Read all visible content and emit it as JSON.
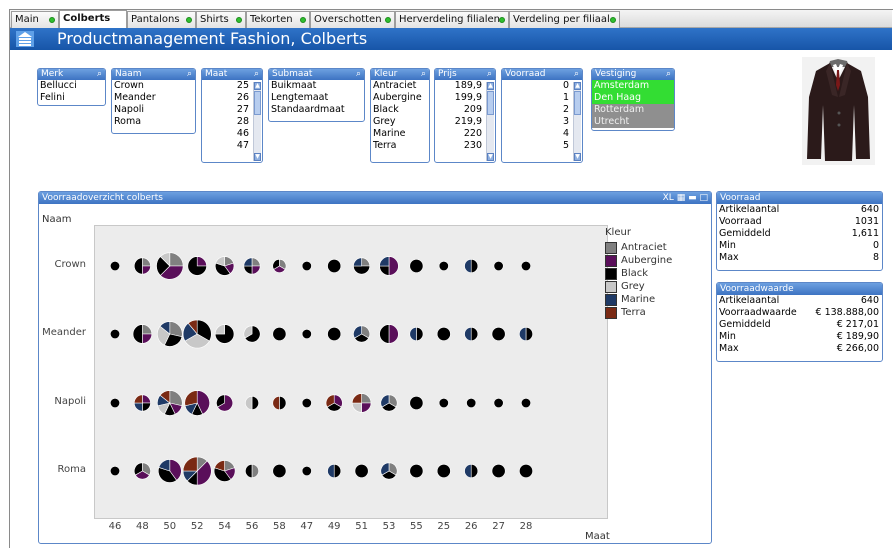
{
  "tabs": [
    {
      "label": "Main"
    },
    {
      "label": "Colberts"
    },
    {
      "label": "Pantalons"
    },
    {
      "label": "Shirts"
    },
    {
      "label": "Tekorten"
    },
    {
      "label": "Overschotten"
    },
    {
      "label": "Herverdeling filialen"
    },
    {
      "label": "Verdeling per filiaal"
    }
  ],
  "header": {
    "title": "Productmanagement Fashion, Colberts"
  },
  "listboxes": {
    "merk": {
      "title": "Merk",
      "items": [
        "Bellucci",
        "Felini"
      ]
    },
    "naam": {
      "title": "Naam",
      "items": [
        "Crown",
        "Meander",
        "Napoli",
        "Roma"
      ]
    },
    "maat": {
      "title": "Maat",
      "items": [
        "25",
        "26",
        "27",
        "28",
        "46",
        "47"
      ]
    },
    "submaat": {
      "title": "Submaat",
      "items": [
        "Buikmaat",
        "Lengtemaat",
        "Standaardmaat"
      ]
    },
    "kleur": {
      "title": "Kleur",
      "items": [
        "Antraciet",
        "Aubergine",
        "Black",
        "Grey",
        "Marine",
        "Terra"
      ]
    },
    "prijs": {
      "title": "Prijs",
      "items": [
        "189,9",
        "199,9",
        "209",
        "219,9",
        "220",
        "230"
      ]
    },
    "voorraad": {
      "title": "Voorraad",
      "items": [
        "0",
        "1",
        "2",
        "3",
        "4",
        "5"
      ]
    },
    "vestiging": {
      "title": "Vestiging",
      "items": [
        "Amsterdam",
        "Den Haag",
        "Rotterdam",
        "Utrecht"
      ],
      "selected": [
        "Amsterdam",
        "Den Haag"
      ]
    }
  },
  "chart": {
    "title": "Voorraadoverzicht colberts",
    "row_dimension": "Naam",
    "x_dimension": "Maat",
    "legend_title": "Kleur"
  },
  "chart_data": {
    "type": "scatter",
    "title": "Voorraadoverzicht colberts",
    "ylabel": "Naam",
    "xlabel": "Maat",
    "categories_y": [
      "Crown",
      "Meander",
      "Napoli",
      "Roma"
    ],
    "categories_x": [
      "46",
      "48",
      "50",
      "52",
      "54",
      "56",
      "58",
      "47",
      "49",
      "51",
      "53",
      "55",
      "25",
      "26",
      "27",
      "28"
    ],
    "series": [
      {
        "name": "Antraciet",
        "color": "#808080"
      },
      {
        "name": "Aubergine",
        "color": "#5a0f5a"
      },
      {
        "name": "Black",
        "color": "#000000"
      },
      {
        "name": "Grey",
        "color": "#c8c8c8"
      },
      {
        "name": "Marine",
        "color": "#1f3a66"
      },
      {
        "name": "Terra",
        "color": "#7a2a14"
      }
    ],
    "bubbles": [
      {
        "row": "Crown",
        "x": "46",
        "size": 1,
        "mix": [
          0,
          0,
          1,
          0,
          0,
          0
        ]
      },
      {
        "row": "Crown",
        "x": "48",
        "size": 3,
        "mix": [
          1,
          1,
          2,
          0,
          0,
          0
        ]
      },
      {
        "row": "Crown",
        "x": "50",
        "size": 8,
        "mix": [
          2,
          3,
          2,
          1,
          0,
          0
        ]
      },
      {
        "row": "Crown",
        "x": "52",
        "size": 4,
        "mix": [
          0,
          1,
          3,
          0,
          0,
          0
        ]
      },
      {
        "row": "Crown",
        "x": "54",
        "size": 4,
        "mix": [
          1,
          1,
          2,
          1,
          0,
          0
        ]
      },
      {
        "row": "Crown",
        "x": "56",
        "size": 3,
        "mix": [
          1,
          1,
          1,
          0,
          1,
          0
        ]
      },
      {
        "row": "Crown",
        "x": "58",
        "size": 2,
        "mix": [
          1,
          1,
          1,
          0,
          0,
          0
        ]
      },
      {
        "row": "Crown",
        "x": "47",
        "size": 1,
        "mix": [
          0,
          0,
          1,
          0,
          0,
          0
        ]
      },
      {
        "row": "Crown",
        "x": "49",
        "size": 2,
        "mix": [
          0,
          0,
          2,
          0,
          0,
          0
        ]
      },
      {
        "row": "Crown",
        "x": "51",
        "size": 3,
        "mix": [
          1,
          0,
          2,
          0,
          1,
          0
        ]
      },
      {
        "row": "Crown",
        "x": "53",
        "size": 4,
        "mix": [
          0,
          2,
          1,
          0,
          1,
          0
        ]
      },
      {
        "row": "Crown",
        "x": "55",
        "size": 2,
        "mix": [
          0,
          0,
          2,
          0,
          0,
          0
        ]
      },
      {
        "row": "Crown",
        "x": "25",
        "size": 1,
        "mix": [
          0,
          0,
          1,
          0,
          0,
          0
        ]
      },
      {
        "row": "Crown",
        "x": "26",
        "size": 2,
        "mix": [
          0,
          0,
          1,
          0,
          1,
          0
        ]
      },
      {
        "row": "Crown",
        "x": "27",
        "size": 1,
        "mix": [
          0,
          0,
          1,
          0,
          0,
          0
        ]
      },
      {
        "row": "Crown",
        "x": "28",
        "size": 1,
        "mix": [
          0,
          0,
          1,
          0,
          0,
          0
        ]
      },
      {
        "row": "Meander",
        "x": "46",
        "size": 1,
        "mix": [
          0,
          0,
          1,
          0,
          0,
          0
        ]
      },
      {
        "row": "Meander",
        "x": "48",
        "size": 4,
        "mix": [
          1,
          1,
          2,
          0,
          0,
          0
        ]
      },
      {
        "row": "Meander",
        "x": "50",
        "size": 7,
        "mix": [
          2,
          0,
          2,
          2,
          1,
          0
        ]
      },
      {
        "row": "Meander",
        "x": "52",
        "size": 9,
        "mix": [
          0,
          0,
          3,
          3,
          2,
          1
        ]
      },
      {
        "row": "Meander",
        "x": "54",
        "size": 4,
        "mix": [
          0,
          0,
          3,
          1,
          0,
          0
        ]
      },
      {
        "row": "Meander",
        "x": "56",
        "size": 3,
        "mix": [
          0,
          0,
          2,
          1,
          0,
          0
        ]
      },
      {
        "row": "Meander",
        "x": "58",
        "size": 2,
        "mix": [
          0,
          0,
          2,
          0,
          0,
          0
        ]
      },
      {
        "row": "Meander",
        "x": "47",
        "size": 1,
        "mix": [
          0,
          0,
          1,
          0,
          0,
          0
        ]
      },
      {
        "row": "Meander",
        "x": "49",
        "size": 2,
        "mix": [
          0,
          0,
          2,
          0,
          0,
          0
        ]
      },
      {
        "row": "Meander",
        "x": "51",
        "size": 3,
        "mix": [
          1,
          0,
          1,
          0,
          1,
          0
        ]
      },
      {
        "row": "Meander",
        "x": "53",
        "size": 4,
        "mix": [
          0,
          2,
          2,
          0,
          0,
          0
        ]
      },
      {
        "row": "Meander",
        "x": "55",
        "size": 2,
        "mix": [
          0,
          0,
          1,
          0,
          1,
          0
        ]
      },
      {
        "row": "Meander",
        "x": "25",
        "size": 2,
        "mix": [
          0,
          0,
          2,
          0,
          0,
          0
        ]
      },
      {
        "row": "Meander",
        "x": "26",
        "size": 2,
        "mix": [
          0,
          0,
          1,
          0,
          1,
          0
        ]
      },
      {
        "row": "Meander",
        "x": "27",
        "size": 2,
        "mix": [
          0,
          0,
          2,
          0,
          0,
          0
        ]
      },
      {
        "row": "Meander",
        "x": "28",
        "size": 2,
        "mix": [
          0,
          0,
          1,
          0,
          1,
          0
        ]
      },
      {
        "row": "Napoli",
        "x": "46",
        "size": 1,
        "mix": [
          0,
          0,
          1,
          0,
          0,
          0
        ]
      },
      {
        "row": "Napoli",
        "x": "48",
        "size": 3,
        "mix": [
          0,
          1,
          1,
          0,
          1,
          1
        ]
      },
      {
        "row": "Napoli",
        "x": "50",
        "size": 7,
        "mix": [
          2,
          1,
          1,
          1,
          1,
          1
        ]
      },
      {
        "row": "Napoli",
        "x": "52",
        "size": 7,
        "mix": [
          0,
          3,
          1,
          0,
          1,
          2
        ]
      },
      {
        "row": "Napoli",
        "x": "54",
        "size": 3,
        "mix": [
          0,
          2,
          1,
          0,
          0,
          0
        ]
      },
      {
        "row": "Napoli",
        "x": "56",
        "size": 2,
        "mix": [
          0,
          0,
          1,
          1,
          0,
          0
        ]
      },
      {
        "row": "Napoli",
        "x": "58",
        "size": 2,
        "mix": [
          0,
          0,
          1,
          0,
          0,
          1
        ]
      },
      {
        "row": "Napoli",
        "x": "47",
        "size": 1,
        "mix": [
          0,
          0,
          1,
          0,
          0,
          0
        ]
      },
      {
        "row": "Napoli",
        "x": "49",
        "size": 3,
        "mix": [
          0,
          1,
          1,
          0,
          0,
          1
        ]
      },
      {
        "row": "Napoli",
        "x": "51",
        "size": 4,
        "mix": [
          1,
          1,
          0,
          1,
          0,
          1
        ]
      },
      {
        "row": "Napoli",
        "x": "53",
        "size": 3,
        "mix": [
          1,
          0,
          1,
          0,
          1,
          0
        ]
      },
      {
        "row": "Napoli",
        "x": "55",
        "size": 2,
        "mix": [
          0,
          0,
          2,
          0,
          0,
          0
        ]
      },
      {
        "row": "Napoli",
        "x": "25",
        "size": 1,
        "mix": [
          0,
          0,
          1,
          0,
          0,
          0
        ]
      },
      {
        "row": "Napoli",
        "x": "26",
        "size": 1,
        "mix": [
          0,
          0,
          1,
          0,
          0,
          0
        ]
      },
      {
        "row": "Napoli",
        "x": "27",
        "size": 1,
        "mix": [
          0,
          0,
          1,
          0,
          0,
          0
        ]
      },
      {
        "row": "Napoli",
        "x": "28",
        "size": 1,
        "mix": [
          0,
          0,
          1,
          0,
          0,
          0
        ]
      },
      {
        "row": "Roma",
        "x": "46",
        "size": 1,
        "mix": [
          0,
          0,
          1,
          0,
          0,
          0
        ]
      },
      {
        "row": "Roma",
        "x": "48",
        "size": 3,
        "mix": [
          1,
          1,
          1,
          0,
          0,
          0
        ]
      },
      {
        "row": "Roma",
        "x": "50",
        "size": 6,
        "mix": [
          0,
          2,
          2,
          0,
          1,
          0
        ]
      },
      {
        "row": "Roma",
        "x": "52",
        "size": 9,
        "mix": [
          1,
          3,
          1,
          0,
          1,
          2
        ]
      },
      {
        "row": "Roma",
        "x": "54",
        "size": 5,
        "mix": [
          1,
          1,
          2,
          0,
          0,
          1
        ]
      },
      {
        "row": "Roma",
        "x": "56",
        "size": 2,
        "mix": [
          1,
          0,
          1,
          0,
          0,
          0
        ]
      },
      {
        "row": "Roma",
        "x": "58",
        "size": 2,
        "mix": [
          0,
          0,
          2,
          0,
          0,
          0
        ]
      },
      {
        "row": "Roma",
        "x": "47",
        "size": 1,
        "mix": [
          0,
          0,
          1,
          0,
          0,
          0
        ]
      },
      {
        "row": "Roma",
        "x": "49",
        "size": 2,
        "mix": [
          0,
          0,
          1,
          0,
          1,
          0
        ]
      },
      {
        "row": "Roma",
        "x": "51",
        "size": 2,
        "mix": [
          0,
          0,
          2,
          0,
          0,
          0
        ]
      },
      {
        "row": "Roma",
        "x": "53",
        "size": 3,
        "mix": [
          1,
          0,
          1,
          0,
          1,
          0
        ]
      },
      {
        "row": "Roma",
        "x": "55",
        "size": 2,
        "mix": [
          0,
          0,
          2,
          0,
          0,
          0
        ]
      },
      {
        "row": "Roma",
        "x": "25",
        "size": 2,
        "mix": [
          0,
          0,
          2,
          0,
          0,
          0
        ]
      },
      {
        "row": "Roma",
        "x": "26",
        "size": 2,
        "mix": [
          0,
          0,
          1,
          0,
          1,
          0
        ]
      },
      {
        "row": "Roma",
        "x": "27",
        "size": 2,
        "mix": [
          0,
          0,
          2,
          0,
          0,
          0
        ]
      },
      {
        "row": "Roma",
        "x": "28",
        "size": 2,
        "mix": [
          0,
          0,
          2,
          0,
          0,
          0
        ]
      }
    ]
  },
  "voorraad_table": {
    "title": "Voorraad",
    "rows": [
      {
        "label": "Artikelaantal",
        "value": "640"
      },
      {
        "label": "Voorraad",
        "value": "1031"
      },
      {
        "label": "Gemiddeld",
        "value": "1,611"
      },
      {
        "label": "Min",
        "value": "0"
      },
      {
        "label": "Max",
        "value": "8"
      }
    ]
  },
  "waarde_table": {
    "title": "Voorraadwaarde",
    "rows": [
      {
        "label": "Artikelaantal",
        "value": "640"
      },
      {
        "label": "Voorraadwaarde",
        "value": "€ 138.888,00"
      },
      {
        "label": "Gemiddeld",
        "value": "€ 217,01"
      },
      {
        "label": "Min",
        "value": "€ 189,90"
      },
      {
        "label": "Max",
        "value": "€ 266,00"
      }
    ]
  },
  "colors": {
    "header_blue": "#1f62b8",
    "selected_green": "#33dd33",
    "excluded_grey": "#8f8f8f"
  },
  "icons": [
    "app-logo-icon",
    "search-icon",
    "excel-export-icon",
    "minimize-icon",
    "maximize-icon",
    "scroll-up-icon",
    "scroll-down-icon"
  ]
}
